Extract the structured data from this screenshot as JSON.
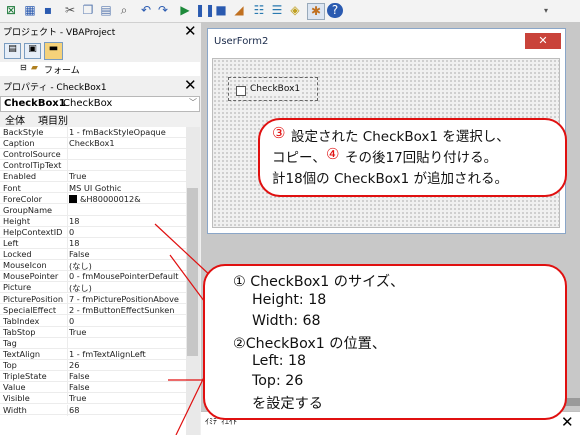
{
  "toolbar": {
    "icons": [
      "excel-icon",
      "grid-icon",
      "save-icon",
      "cut-icon",
      "copy-icon",
      "paste-icon",
      "find-icon",
      "undo-icon",
      "redo-icon",
      "run-icon",
      "pause-icon",
      "stop-icon",
      "design-icon",
      "explorer-icon",
      "properties-icon",
      "object-browser-icon",
      "toolbox-icon",
      "help-icon"
    ]
  },
  "project": {
    "title": "プロジェクト - VBAProject",
    "tree_item": "フォーム"
  },
  "properties": {
    "title": "プロパティ - CheckBox1",
    "object_name": "CheckBox1",
    "object_type": "CheckBox",
    "tab_all": "全体",
    "tab_category": "項目別",
    "rows": [
      {
        "name": "BackStyle",
        "value": "1 - fmBackStyleOpaque"
      },
      {
        "name": "Caption",
        "value": "CheckBox1"
      },
      {
        "name": "ControlSource",
        "value": ""
      },
      {
        "name": "ControlTipText",
        "value": ""
      },
      {
        "name": "Enabled",
        "value": "True"
      },
      {
        "name": "Font",
        "value": "MS UI Gothic"
      },
      {
        "name": "ForeColor",
        "value": "&H80000012&"
      },
      {
        "name": "GroupName",
        "value": ""
      },
      {
        "name": "Height",
        "value": "18"
      },
      {
        "name": "HelpContextID",
        "value": "0"
      },
      {
        "name": "Left",
        "value": "18"
      },
      {
        "name": "Locked",
        "value": "False"
      },
      {
        "name": "MouseIcon",
        "value": "(なし)"
      },
      {
        "name": "MousePointer",
        "value": "0 - fmMousePointerDefault"
      },
      {
        "name": "Picture",
        "value": "(なし)"
      },
      {
        "name": "PicturePosition",
        "value": "7 - fmPicturePositionAbove"
      },
      {
        "name": "SpecialEffect",
        "value": "2 - fmButtonEffectSunken"
      },
      {
        "name": "TabIndex",
        "value": "0"
      },
      {
        "name": "TabStop",
        "value": "True"
      },
      {
        "name": "Tag",
        "value": ""
      },
      {
        "name": "TextAlign",
        "value": "1 - fmTextAlignLeft"
      },
      {
        "name": "Top",
        "value": "26"
      },
      {
        "name": "TripleState",
        "value": "False"
      },
      {
        "name": "Value",
        "value": "False"
      },
      {
        "name": "Visible",
        "value": "True"
      },
      {
        "name": "Width",
        "value": "68"
      }
    ]
  },
  "userform": {
    "title": "UserForm2",
    "checkbox_label": "CheckBox1"
  },
  "immediate": {
    "title": "ｲﾐﾃﾞｨｴｲﾄ"
  },
  "callout_top": {
    "num": "③",
    "line1": "設定された CheckBox1 を選択し、",
    "line2a": "コピー、",
    "num2": "④",
    "line2b": "その後17回貼り付ける。",
    "line3": "計18個の CheckBox1 が追加される。"
  },
  "callout_bottom": {
    "line1": "① CheckBox1 のサイズ、",
    "line2": "Height: 18",
    "line3": "Width:  68",
    "line4": "②CheckBox1 の位置、",
    "line5": "Left:    18",
    "line6": "Top:     26",
    "line7": "を設定する"
  },
  "colors": {
    "accent_red": "#e01010",
    "close_red": "#c9433a"
  }
}
